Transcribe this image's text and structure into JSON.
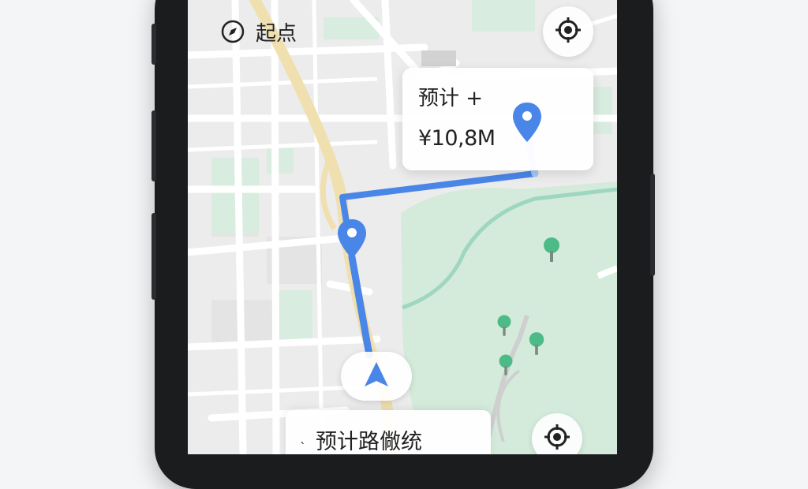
{
  "top_bar": {
    "icon": "compass-icon",
    "label": "起点"
  },
  "info_card": {
    "line1": "预计 +",
    "line2": "¥10,8M"
  },
  "bottom_card": {
    "caret": "ˎ",
    "label": "预计路僘统"
  },
  "icons": {
    "locate_top": "crosshair-icon",
    "locate_bottom": "crosshair-icon",
    "navigation": "navigation-arrow-icon",
    "pin": "map-pin-icon",
    "tree": "tree-icon"
  },
  "colors": {
    "route": "#4a86e8",
    "route_light": "#a8c8f0",
    "pin": "#4a86e8",
    "park": "#d4ebdb",
    "highway": "#f0e0b0",
    "road": "#ffffff",
    "block": "#e6e6e6"
  }
}
